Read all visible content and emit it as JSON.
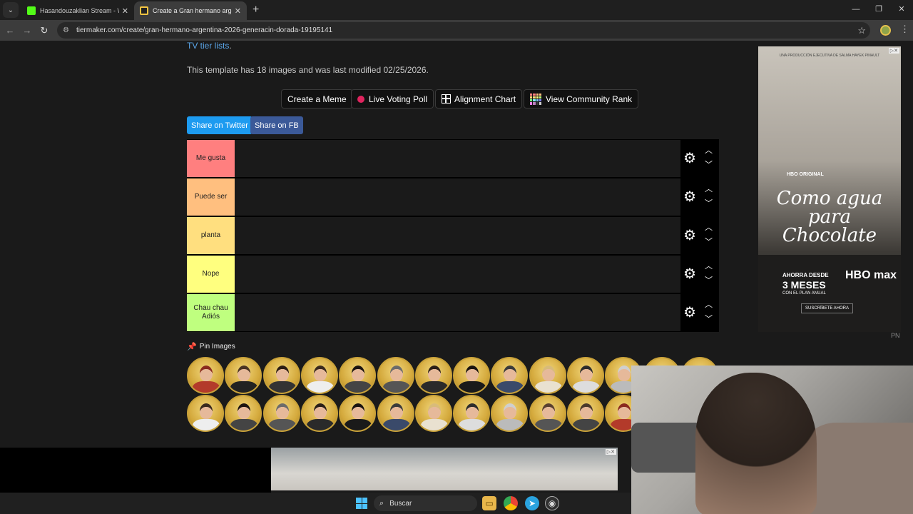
{
  "browser": {
    "tabs": [
      {
        "title": "Hasandouzaklian Stream - Wat",
        "favicon_color": "#53fc18",
        "active": false
      },
      {
        "title": "Create a Gran hermano argenti",
        "favicon_color": "#f5c542",
        "active": true
      }
    ],
    "url": "tiermaker.com/create/gran-hermano-argentina-2026-generacin-dorada-19195141"
  },
  "page": {
    "link_text": "TV tier lists",
    "info_text": "This template has 18 images and was last modified 02/25/2026.",
    "buttons": {
      "create_meme": "Create a Meme",
      "live_voting": "Live Voting Poll",
      "alignment": "Alignment Chart",
      "community_rank": "View Community Rank"
    },
    "share": {
      "twitter": "Share on Twitter",
      "fb": "Share on FB",
      "twitter_color": "#1d9bf0",
      "fb_color": "#3b5998"
    },
    "tiers": [
      {
        "label": "Me gusta",
        "color": "#ff7f7f"
      },
      {
        "label": "Puede ser",
        "color": "#ffbf7f"
      },
      {
        "label": "planta",
        "color": "#ffdf7f"
      },
      {
        "label": "Nope",
        "color": "#ffff7f"
      },
      {
        "label": "Chau chau Adiós",
        "color": "#bfff7f"
      }
    ],
    "pin_images_label": "Pin Images"
  },
  "ad_side": {
    "tagline": "UNA PRODUCCIÓN EJECUTIVA DE SALMA HAYEK PINAULT",
    "brand": "HBO ORIGINAL",
    "title": "Como agua para Chocolate",
    "offer_line1": "AHORRA DESDE",
    "offer_line2": "3 MESES",
    "offer_line3": "CON EL PLAN ANUAL",
    "brand2": "HBO max",
    "cta": "SUSCRÍBETE AHORA",
    "corner": "PN"
  },
  "taskbar": {
    "search_placeholder": "Buscar"
  }
}
